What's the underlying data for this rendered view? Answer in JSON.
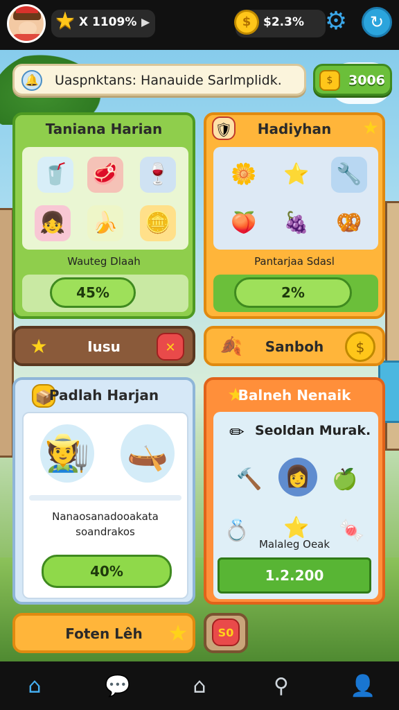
{
  "topbar": {
    "stars_value": "X 1109%",
    "coins_value": "$2.3%",
    "icons": {
      "avatar": "player-avatar",
      "star": "star-icon",
      "coin": "coin-icon",
      "settings": "gear-icon",
      "refresh": "refresh-icon"
    }
  },
  "banner": {
    "text": "Uaspnktans: Hanauide Sarlmplidk.",
    "bonus_value": "3006"
  },
  "panels": {
    "p1": {
      "title": "Taniana Harian",
      "label": "Wauteg Dlaah",
      "progress": "45%",
      "progress_fraction": 0.45
    },
    "p2": {
      "title": "Hadiyhan",
      "label": "Pantarjaa Sdasl",
      "progress": "2%",
      "progress_fraction": 0.02
    },
    "p3": {
      "title": "Padlah Harjan",
      "description_line1": "Nanaosanadooakata",
      "description_line2": "soandrakos",
      "progress": "40%",
      "progress_fraction": 0.4
    },
    "p4": {
      "title": "Balneh Nenaik",
      "subtitle": "Seoldan Murak.",
      "label": "Malaleg Oeak",
      "value": "1.2.200"
    }
  },
  "buttons": {
    "row1": "Iusu",
    "row2": "Sanboh",
    "bottom1": "Foten Lêh",
    "bottom2_badge": "S0"
  },
  "nav": [
    "home-icon",
    "chat-icon",
    "house-icon",
    "search-icon",
    "profile-icon"
  ],
  "colors": {
    "green_panel": "#8fce4c",
    "orange_panel": "#ffb53a",
    "blue_panel": "#d6e8f7",
    "red_panel": "#ff8f3a",
    "accent_blue": "#2ba4dc"
  }
}
